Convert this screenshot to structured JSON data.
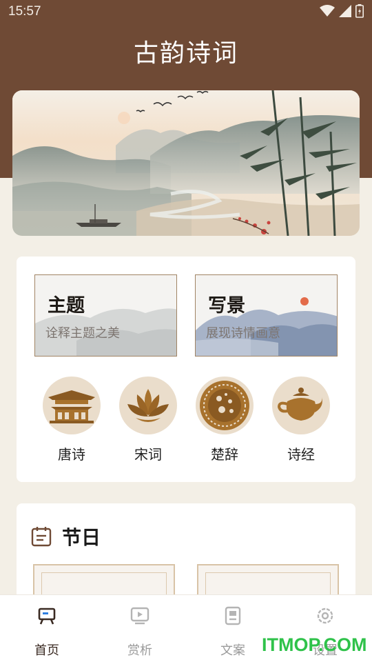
{
  "status": {
    "time": "15:57"
  },
  "app": {
    "title": "古韵诗词"
  },
  "features": [
    {
      "title": "主题",
      "subtitle": "诠释主题之美"
    },
    {
      "title": "写景",
      "subtitle": "展现诗情画意"
    }
  ],
  "categories": [
    {
      "label": "唐诗",
      "icon": "temple-icon"
    },
    {
      "label": "宋词",
      "icon": "lotus-icon"
    },
    {
      "label": "楚辞",
      "icon": "mooncake-icon"
    },
    {
      "label": "诗经",
      "icon": "teapot-icon"
    }
  ],
  "holiday": {
    "title": "节日"
  },
  "nav": [
    {
      "label": "首页",
      "icon": "home-easel-icon",
      "active": true
    },
    {
      "label": "赏析",
      "icon": "play-screen-icon",
      "active": false
    },
    {
      "label": "文案",
      "icon": "document-icon",
      "active": false
    },
    {
      "label": "设置",
      "icon": "gear-icon",
      "active": false
    }
  ],
  "watermark": "ITMOP.COM",
  "colors": {
    "header": "#6f4a35",
    "accent": "#a8722d",
    "background": "#f3efe6"
  }
}
